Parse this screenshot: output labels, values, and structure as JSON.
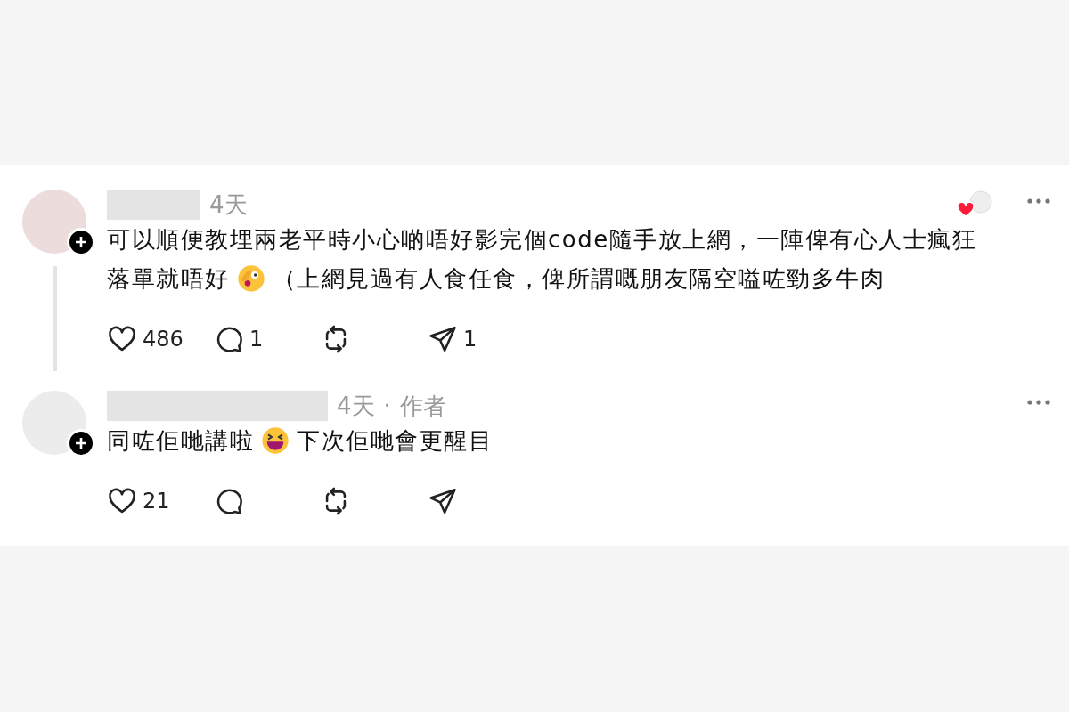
{
  "comments": [
    {
      "time": "4天",
      "liked_by_author": true,
      "thread_line": true,
      "lines": [
        [
          {
            "kind": "text",
            "text": "可以順便教埋兩老平時小心啲唔好影完個code隨手放上網，一陣俾有心人士瘋狂"
          }
        ],
        [
          {
            "kind": "text",
            "text": "落單就唔好"
          },
          {
            "kind": "peek-face"
          },
          {
            "kind": "text",
            "text": "（上網見過有人食任食，俾所謂嘅朋友隔空嗌咗勁多牛肉"
          }
        ]
      ],
      "actions": [
        {
          "kind": "like",
          "count": "486"
        },
        {
          "kind": "reply",
          "count": "1"
        },
        {
          "kind": "repost"
        },
        {
          "kind": "share",
          "count": "1"
        }
      ]
    },
    {
      "time": "4天",
      "separator": "·",
      "badge": "作者",
      "liked_by_author": false,
      "thread_line": false,
      "lines": [
        [
          {
            "kind": "text",
            "text": "同咗佢哋講啦"
          },
          {
            "kind": "laugh-face"
          },
          {
            "kind": "text",
            "text": "下次佢哋會更醒目"
          }
        ]
      ],
      "actions": [
        {
          "kind": "like",
          "count": "21"
        },
        {
          "kind": "reply"
        },
        {
          "kind": "repost"
        },
        {
          "kind": "share"
        }
      ]
    }
  ]
}
